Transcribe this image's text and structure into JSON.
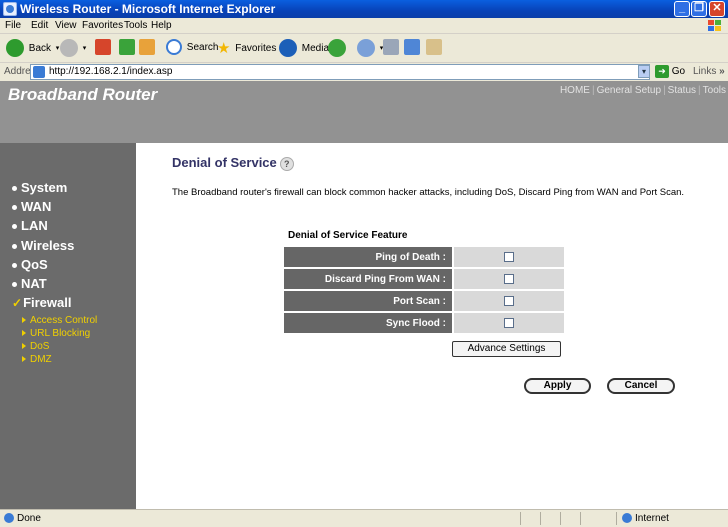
{
  "window": {
    "title": "Wireless Router - Microsoft Internet Explorer",
    "controls": [
      "_",
      "❐",
      "✕"
    ]
  },
  "menu": [
    "File",
    "Edit",
    "View",
    "Favorites",
    "Tools",
    "Help"
  ],
  "toolbar": {
    "back": "Back",
    "search": "Search",
    "favorites": "Favorites",
    "media": "Media"
  },
  "address": {
    "label": "Address",
    "url": "http://192.168.2.1/index.asp",
    "go": "Go",
    "links": "Links"
  },
  "banner": {
    "brand": "Broadband Router",
    "topnav": [
      "HOME",
      "General Setup",
      "Status",
      "Tools"
    ]
  },
  "sidebar": {
    "items": [
      {
        "label": "System"
      },
      {
        "label": "WAN"
      },
      {
        "label": "LAN"
      },
      {
        "label": "Wireless"
      },
      {
        "label": "QoS"
      },
      {
        "label": "NAT"
      },
      {
        "label": "Firewall"
      }
    ],
    "firewall_sub": [
      "Access Control",
      "URL Blocking",
      "DoS",
      "DMZ"
    ]
  },
  "content": {
    "heading": "Denial of Service",
    "description": "The Broadband router's firewall can block common hacker attacks, including DoS, Discard Ping from WAN and Port Scan.",
    "feature_title": "Denial of Service Feature",
    "features": [
      {
        "label": "Ping of Death :",
        "checked": false
      },
      {
        "label": "Discard Ping From WAN :",
        "checked": false
      },
      {
        "label": "Port Scan :",
        "checked": false
      },
      {
        "label": "Sync Flood :",
        "checked": false
      }
    ],
    "advance_button": "Advance Settings",
    "apply_button": "Apply",
    "cancel_button": "Cancel"
  },
  "status": {
    "left": "Done",
    "zone": "Internet"
  },
  "colors": {
    "banner": "#929292",
    "sidebar": "#6b6b6b",
    "heading": "#333366",
    "submenu": "#f0d000"
  }
}
